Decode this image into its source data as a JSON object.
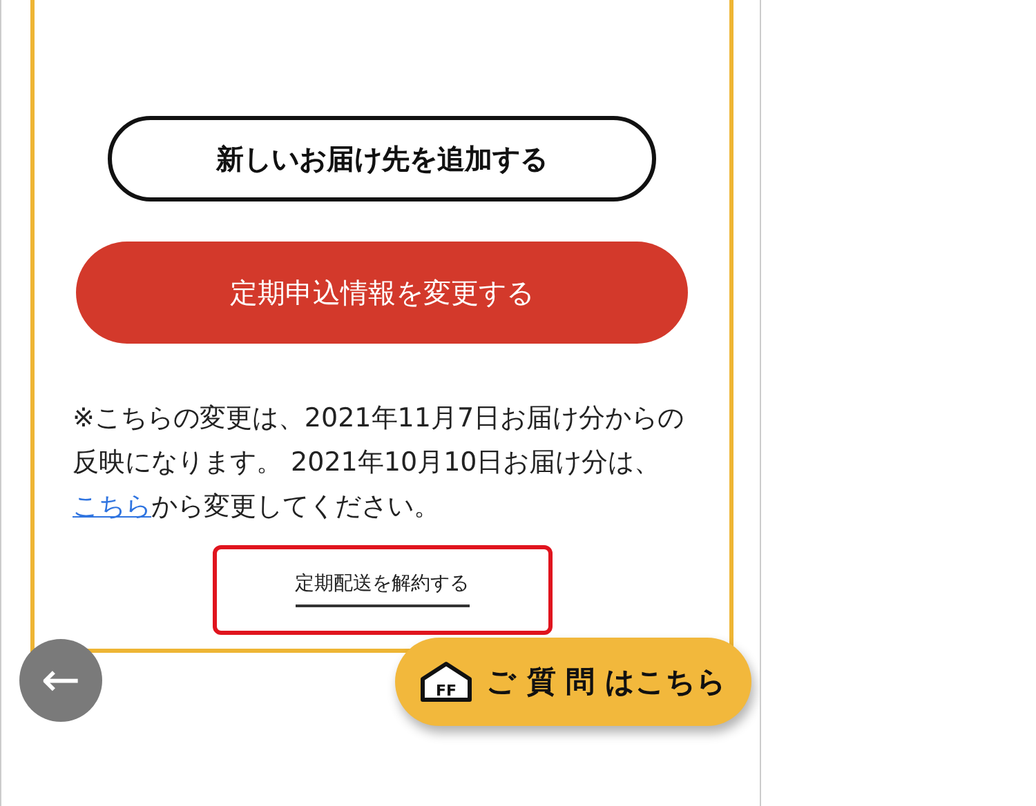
{
  "add_address_button": {
    "label": "新しいお届け先を追加する"
  },
  "change_button": {
    "label": "定期申込情報を変更する"
  },
  "note": {
    "before": "※こちらの変更は、2021年11月7日お届け分からの反映になります。 2021年10月10日お届け分は、",
    "link": "こちら",
    "after": "から変更してください。"
  },
  "cancel_link": {
    "label": "定期配送を解約する",
    "highlighted": true
  },
  "back_button": {
    "icon": "←"
  },
  "faq_button": {
    "label": "ご 質 問 はこちら",
    "logo": "FF"
  }
}
